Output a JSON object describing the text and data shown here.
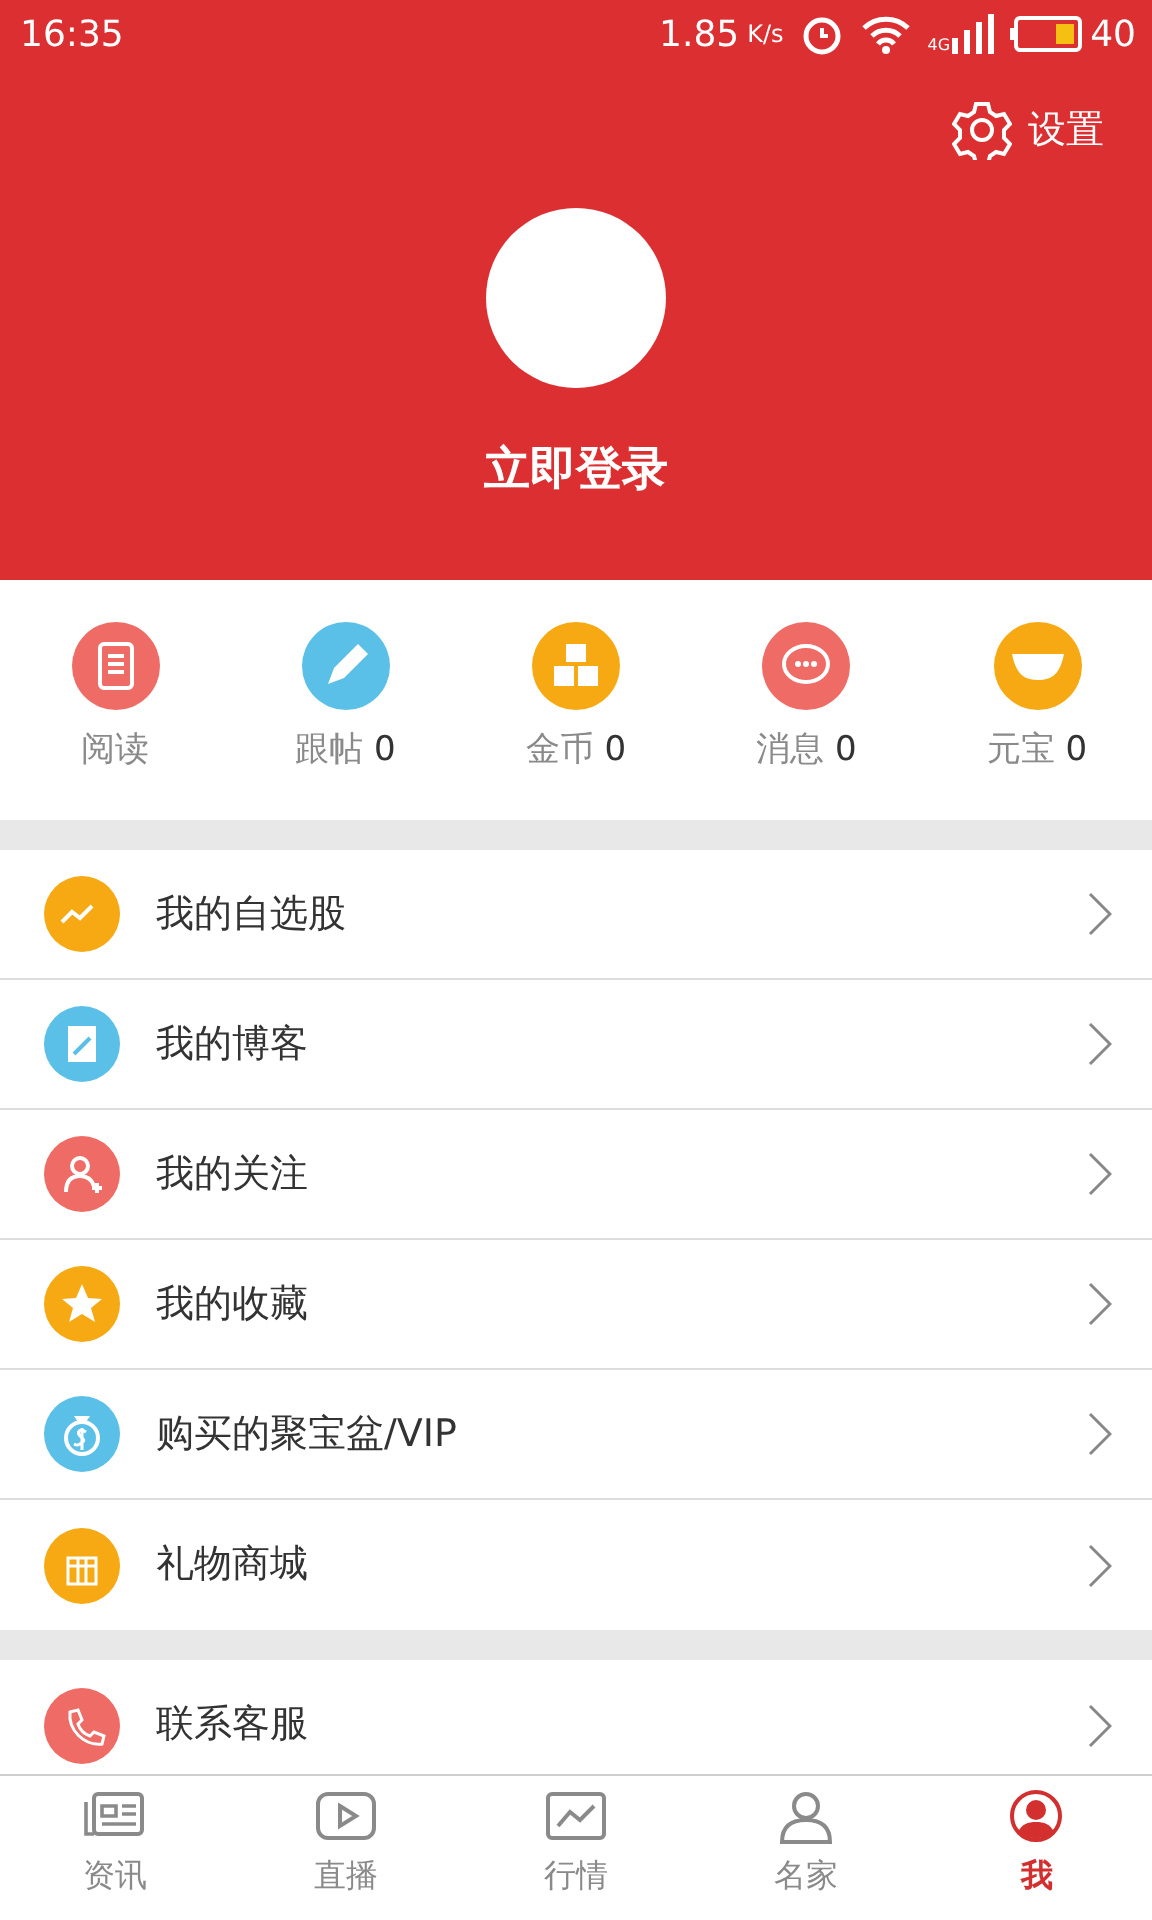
{
  "status_bar": {
    "time": "16:35",
    "speed": "1.85",
    "speed_unit": "K/s",
    "network": "4G",
    "battery": "40"
  },
  "header": {
    "settings": "设置",
    "login": "立即登录"
  },
  "stats": [
    {
      "label": "阅读",
      "color": "#ef6b65"
    },
    {
      "label": "跟帖",
      "count": "0",
      "color": "#5bc0e8"
    },
    {
      "label": "金币",
      "count": "0",
      "color": "#f6a912"
    },
    {
      "label": "消息",
      "count": "0",
      "color": "#ef6b65"
    },
    {
      "label": "元宝",
      "count": "0",
      "color": "#f6a912"
    }
  ],
  "menu_groups": [
    [
      {
        "label": "我的自选股",
        "color": "#f6a912"
      },
      {
        "label": "我的博客",
        "color": "#5bc0e8"
      },
      {
        "label": "我的关注",
        "color": "#ef6b65"
      },
      {
        "label": "我的收藏",
        "color": "#f6a912"
      },
      {
        "label": "购买的聚宝盆/VIP",
        "color": "#5bc0e8"
      },
      {
        "label": "礼物商城",
        "color": "#f6a912"
      }
    ],
    [
      {
        "label": "联系客服",
        "color": "#ef6b65"
      }
    ]
  ],
  "tab_bar": [
    {
      "label": "资讯",
      "selected": false
    },
    {
      "label": "直播",
      "selected": false
    },
    {
      "label": "行情",
      "selected": false
    },
    {
      "label": "名家",
      "selected": false
    },
    {
      "label": "我",
      "selected": true
    }
  ]
}
